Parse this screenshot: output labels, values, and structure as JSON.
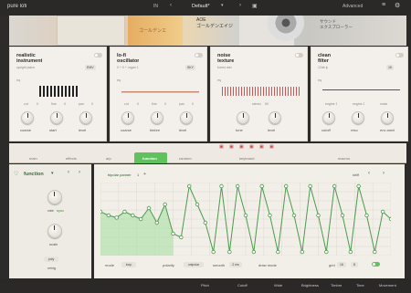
{
  "header": {
    "app_title": "pure lofi",
    "preset_group": "IN",
    "preset_name": "Default*",
    "advanced_label": "Advanced",
    "prev_icon": "chevron-left-icon",
    "next_icon": "chevron-right-icon",
    "menu_icon": "hamburger-icon",
    "save_icon": "save-icon",
    "settings_icon": "gear-icon"
  },
  "artwork": {
    "cassette_text": "AOE\nゴールデンエイジ",
    "pressed_text": "サウンド\nエクスプローラー",
    "label_text": "ゴールデンエ"
  },
  "modules": [
    {
      "title": "realistic\ninstrument",
      "sub": "upright piano",
      "badge": "EMV",
      "eq_label": "eq",
      "knobs": [
        {
          "label": "cut",
          "value": "0"
        },
        {
          "label": "fine",
          "value": "0"
        },
        {
          "label": "pan",
          "value": "0"
        }
      ],
      "big_knobs": [
        "coarse",
        "start",
        "level"
      ]
    },
    {
      "title": "lo-fi\noscillator",
      "sub": "0 + 0 + organ 1",
      "badge": "SKY",
      "eq_label": "eq",
      "knobs": [
        {
          "label": "cut",
          "value": "0"
        },
        {
          "label": "fine",
          "value": "0"
        },
        {
          "label": "pan",
          "value": "0"
        }
      ],
      "big_knobs": [
        "coarse",
        "timbre",
        "level"
      ]
    },
    {
      "title": "noise\ntexture",
      "sub": "forest rain",
      "badge": "",
      "eq_label": "eq",
      "knobs": [
        {
          "label": "stereo",
          "value": "50"
        }
      ],
      "big_knobs": [
        "tune",
        "level"
      ]
    },
    {
      "title": "clean\nfilter",
      "sub": "12db lp",
      "badge": "1K",
      "eq_label": "eq",
      "knobs": [
        {
          "label": "engine 1",
          "value": ""
        },
        {
          "label": "engine 2",
          "value": ""
        },
        {
          "label": "noise",
          "value": ""
        }
      ],
      "big_knobs": [
        "cutoff",
        "reso",
        "env amnt"
      ]
    }
  ],
  "tabs": [
    "main",
    "effects",
    "arp",
    "function",
    "random",
    "keyboard",
    "macros"
  ],
  "active_tab": "function",
  "left_panel": {
    "title": "function",
    "rate_label": "rate",
    "sync_label": "sync",
    "scale_label": "scale",
    "poly_label": "poly",
    "retrig_label": "retrig"
  },
  "function_editor": {
    "target": "bipolar panner",
    "page_num": "1",
    "add_label": "+",
    "shift_label": "shift",
    "mode_label": "mode",
    "mode_value": "loop",
    "polarity_label": "polarity",
    "polarity_value": "unipolar",
    "smooth_label": "smooth",
    "smooth_value": "2 ms",
    "draw_label": "draw mode",
    "grid_label": "grid",
    "grid_value": "16",
    "grid_div": "8"
  },
  "footer": {
    "pitch_label": "Pitch",
    "cutoff_label": "Cutoff",
    "width_label": "Wide",
    "brightness_label": "Brightness",
    "timbre_label": "Timbre",
    "time_label": "Time",
    "movement_label": "Movement"
  },
  "chart_data": {
    "type": "line",
    "x": [
      0,
      1,
      2,
      3,
      4,
      5,
      6,
      7,
      8,
      9,
      10,
      11,
      12,
      13,
      14,
      15,
      16,
      17,
      18,
      19,
      20,
      21,
      22,
      23,
      24,
      25,
      26,
      27,
      28,
      29,
      30,
      31,
      32,
      33,
      34,
      35,
      36
    ],
    "y": [
      0.6,
      0.55,
      0.52,
      0.6,
      0.55,
      0.5,
      0.65,
      0.45,
      0.7,
      0.3,
      0.25,
      0.95,
      0.7,
      0.45,
      0.05,
      0.95,
      0.05,
      0.95,
      0.55,
      0.05,
      0.95,
      0.55,
      0.05,
      0.95,
      0.55,
      0.05,
      0.95,
      0.55,
      0.05,
      0.95,
      0.55,
      0.05,
      0.95,
      0.55,
      0.05,
      0.6,
      0.5
    ],
    "xlim": [
      0,
      36
    ],
    "ylim": [
      0,
      1
    ],
    "grid": true,
    "fill_to": 9
  }
}
